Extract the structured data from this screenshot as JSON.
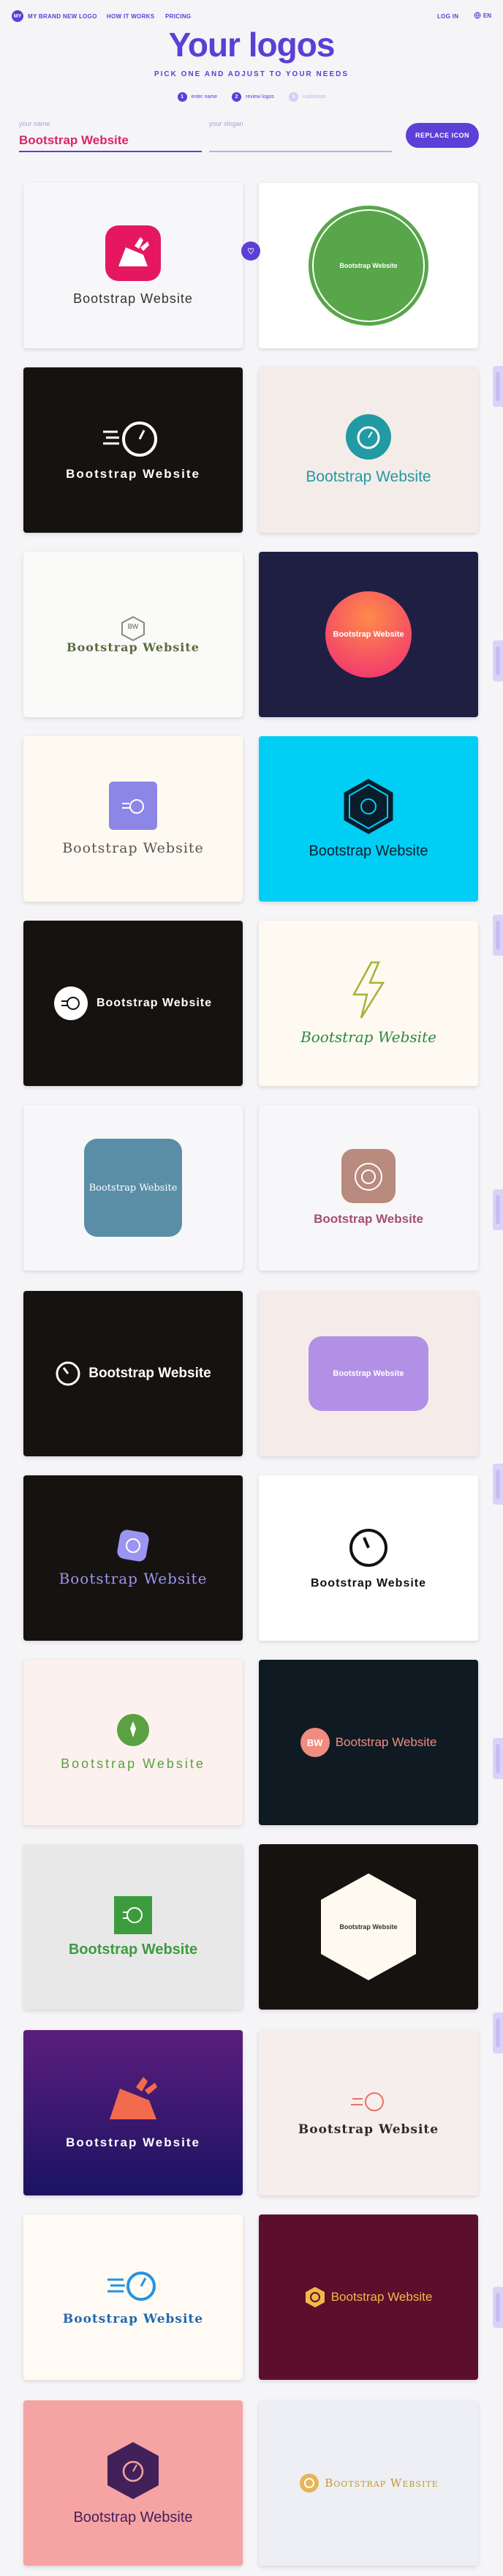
{
  "nav": {
    "brand_logo": "MY",
    "brand": "MY BRAND NEW LOGO",
    "links": [
      "HOW IT WORKS",
      "PRICING"
    ],
    "login": "LOG IN",
    "lang": "EN"
  },
  "header": {
    "title": "Your logos",
    "subtitle": "PICK ONE AND ADJUST TO YOUR NEEDS"
  },
  "steps": [
    {
      "num": "1",
      "label": "enter name"
    },
    {
      "num": "2",
      "label": "review logos"
    },
    {
      "num": "3",
      "label": "customize"
    }
  ],
  "form": {
    "name_label": "your name",
    "name_value": "Bootstrap Website",
    "slogan_label": "your slogan",
    "replace_label": "REPLACE ICON"
  },
  "brand_text": "Bootstrap Website",
  "monogram": "BW",
  "hover_badge": "♡",
  "colors": {
    "accent": "#5b3fd6",
    "name_value": "#d8266b"
  }
}
